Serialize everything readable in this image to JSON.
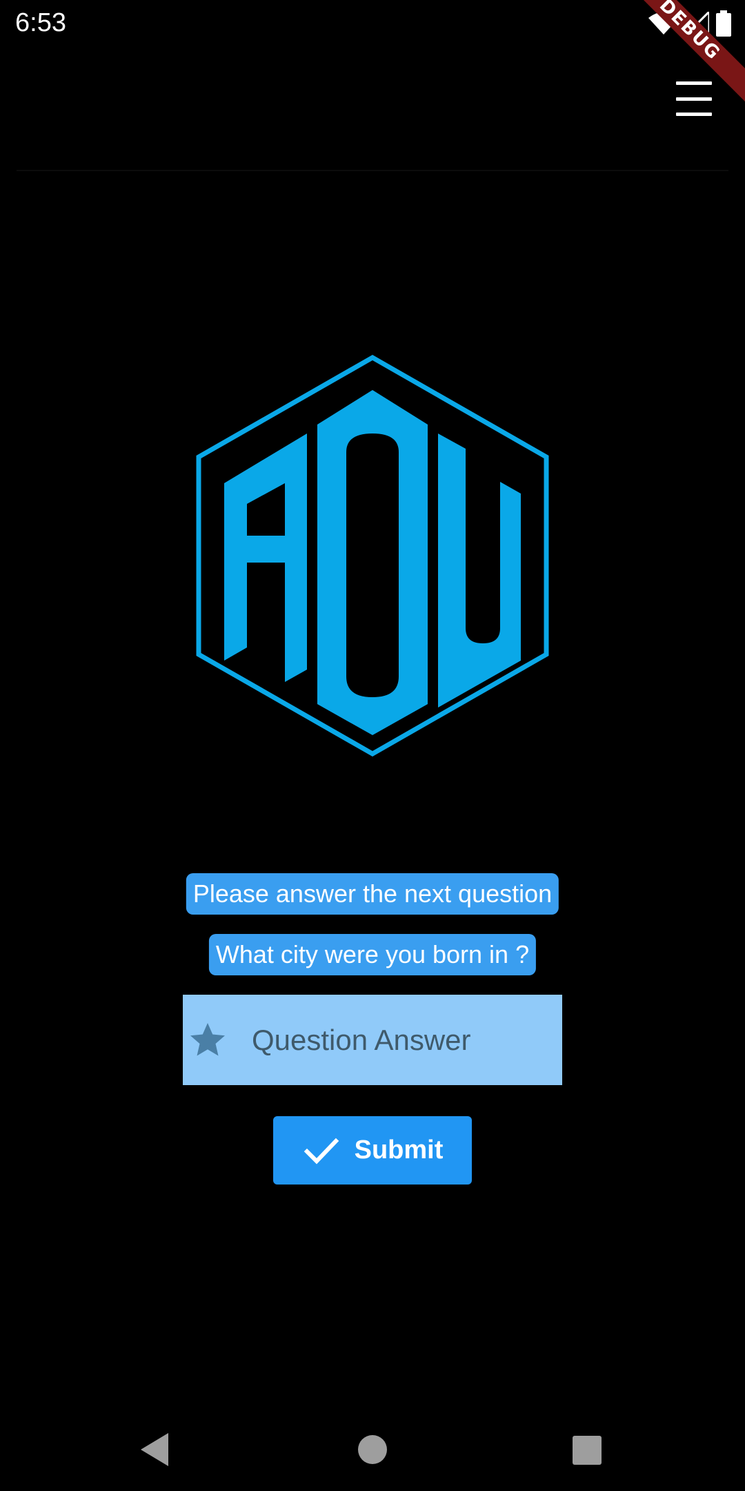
{
  "status_bar": {
    "time": "6:53",
    "debug_label": "DEBUG",
    "icons": [
      "wifi-icon",
      "signal-icon",
      "battery-icon"
    ]
  },
  "header": {
    "menu_icon": "hamburger-menu-icon"
  },
  "logo": {
    "text": "ADU",
    "color": "#0aa8e8"
  },
  "prompt": {
    "instruction": "Please answer the next question",
    "question": "What city were you born in ?"
  },
  "answer_field": {
    "icon": "star-icon",
    "placeholder": "Question Answer",
    "value": ""
  },
  "submit_button": {
    "icon": "check-icon",
    "label": "Submit"
  },
  "navigation": {
    "buttons": [
      "back-icon",
      "home-icon",
      "recents-icon"
    ]
  },
  "colors": {
    "background": "#000000",
    "chip": "#3a9ef0",
    "field": "#90caf9",
    "button": "#2196f3",
    "debug_banner": "#7a1616"
  }
}
